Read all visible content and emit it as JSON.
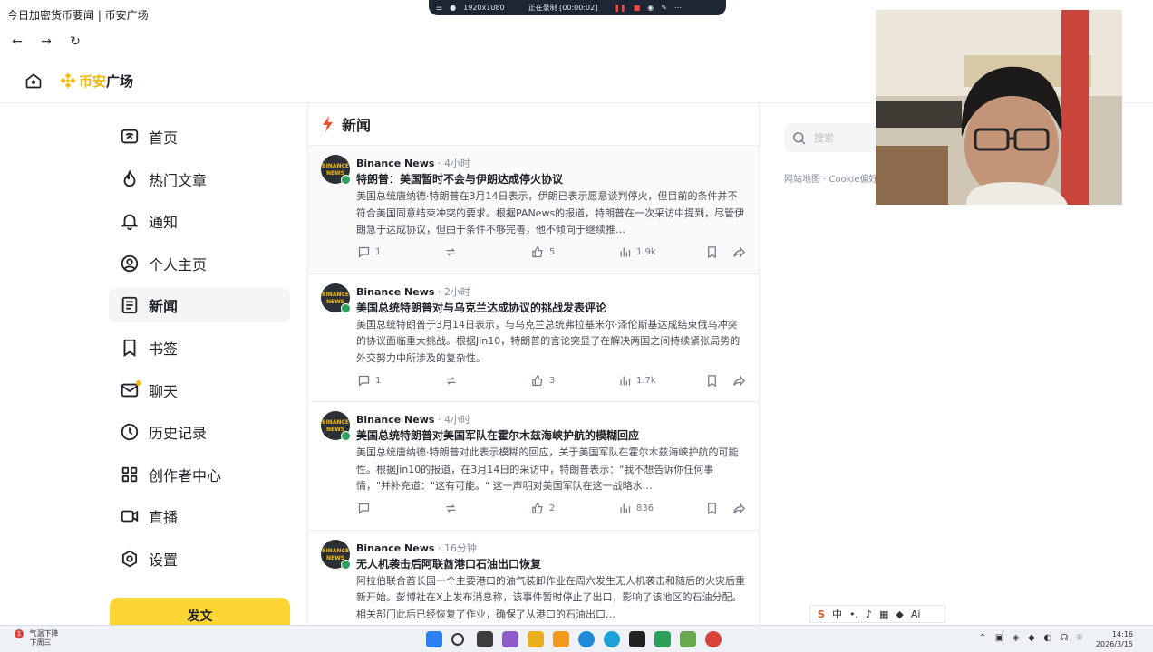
{
  "window": {
    "title": "今日加密货币要闻 | 币安广场"
  },
  "recorder": {
    "resolution": "1920x1080",
    "status": "正在录制 [00:00:02]"
  },
  "header": {
    "brand_gold": "币安",
    "brand_dark": "广场"
  },
  "sidebar": {
    "items": [
      {
        "label": "首页",
        "icon": "home-icon"
      },
      {
        "label": "热门文章",
        "icon": "flame-icon"
      },
      {
        "label": "通知",
        "icon": "bell-icon"
      },
      {
        "label": "个人主页",
        "icon": "user-circle-icon"
      },
      {
        "label": "新闻",
        "icon": "news-icon",
        "active": true
      },
      {
        "label": "书签",
        "icon": "bookmark-icon"
      },
      {
        "label": "聊天",
        "icon": "mail-icon"
      },
      {
        "label": "历史记录",
        "icon": "clock-icon"
      },
      {
        "label": "创作者中心",
        "icon": "grid-icon"
      },
      {
        "label": "直播",
        "icon": "video-icon"
      },
      {
        "label": "设置",
        "icon": "gear-icon"
      }
    ],
    "post_button": "发文"
  },
  "feed": {
    "title": "新闻",
    "posts": [
      {
        "author": "Binance News",
        "time": "4小时",
        "title": "特朗普：美国暂时不会与伊朗达成停火协议",
        "body": "美国总统唐纳德·特朗普在3月14日表示，伊朗已表示愿意谈判停火，但目前的条件并不符合美国同意结束冲突的要求。根据PANews的报道，特朗普在一次采访中提到，尽管伊朗急于达成协议，但由于条件不够完善，他不倾向于继续推…",
        "comments": "1",
        "likes": "5",
        "views": "1.9k"
      },
      {
        "author": "Binance News",
        "time": "2小时",
        "title": "美国总统特朗普对与乌克兰达成协议的挑战发表评论",
        "body": "美国总统特朗普于3月14日表示，与乌克兰总统弗拉基米尔·泽伦斯基达成结束俄乌冲突的协议面临重大挑战。根据Jin10，特朗普的言论突显了在解决两国之间持续紧张局势的外交努力中所涉及的复杂性。",
        "comments": "1",
        "likes": "3",
        "views": "1.7k"
      },
      {
        "author": "Binance News",
        "time": "4小时",
        "title": "美国总统特朗普对美国军队在霍尔木兹海峡护航的模糊回应",
        "body": "美国总统唐纳德·特朗普对此表示模糊的回应，关于美国军队在霍尔木兹海峡护航的可能性。根据Jin10的报道，在3月14日的采访中，特朗普表示：\"我不想告诉你任何事情，\"并补充道：\"这有可能。\" 这一声明对美国军队在这一战略水…",
        "comments": "",
        "likes": "2",
        "views": "836"
      },
      {
        "author": "Binance News",
        "time": "16分钟",
        "title": "无人机袭击后阿联酋港口石油出口恢复",
        "body": "阿拉伯联合酋长国一个主要港口的油气装卸作业在周六发生无人机袭击和随后的火灾后重新开始。彭博社在X上发布消息称，该事件暂时停止了出口，影响了该地区的石油分配。相关部门此后已经恢复了作业，确保了从港口的石油出口…",
        "comments": "",
        "likes": "",
        "views": ""
      }
    ]
  },
  "right": {
    "search_placeholder": "搜索",
    "footer": "网站地图 · Cookie偏好"
  },
  "ime": {
    "label": "中",
    "ai": "Ai"
  },
  "taskbar": {
    "weather_line1": "气温下降",
    "weather_line2": "下周三",
    "weather_badge": "1",
    "time": "14:16",
    "date": "2026/3/15"
  },
  "colors": {
    "accent": "#f0b90b",
    "button": "#fcd535",
    "text": "#1e2329",
    "muted": "#848e9c"
  }
}
